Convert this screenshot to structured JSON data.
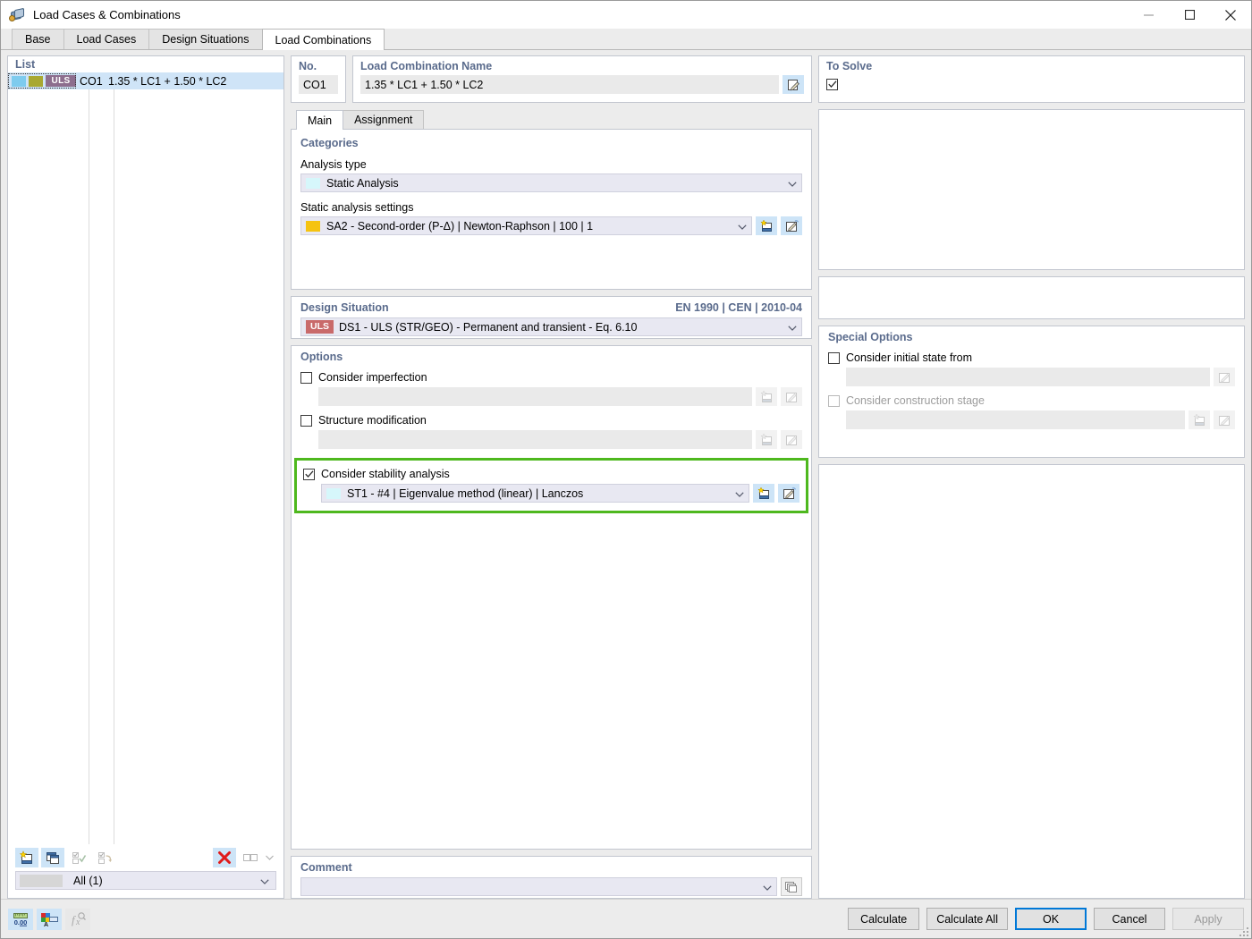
{
  "window": {
    "title": "Load Cases & Combinations",
    "icon": "load-cases-icon",
    "minimize_label": "—",
    "maximize_label": "□",
    "close_label": "✕"
  },
  "tabs": [
    {
      "label": "Base",
      "active": false
    },
    {
      "label": "Load Cases",
      "active": false
    },
    {
      "label": "Design Situations",
      "active": false
    },
    {
      "label": "Load Combinations",
      "active": true
    }
  ],
  "list": {
    "header": "List",
    "rows": [
      {
        "badges": [
          {
            "name": "color-swatch-blue",
            "color": "#7ecbee"
          },
          {
            "name": "color-swatch-olive",
            "color": "#a8a832"
          },
          {
            "name": "uls-badge",
            "color": "#8d6e8e",
            "label": "ULS"
          }
        ],
        "no": "CO1",
        "name": "1.35 * LC1 + 1.50 * LC2"
      }
    ],
    "toolbar": [
      {
        "name": "new-button",
        "icon": "new-icon",
        "state": "enabled"
      },
      {
        "name": "copy-button",
        "icon": "copy-icon",
        "state": "enabled"
      },
      {
        "name": "select-all-button",
        "icon": "check-all-icon",
        "state": "disabled"
      },
      {
        "name": "invert-selection-button",
        "icon": "invert-selection-icon",
        "state": "disabled"
      },
      {
        "name": "delete-button",
        "icon": "delete-x-icon",
        "state": "enabled"
      },
      {
        "name": "view-layout-button",
        "icon": "columns-icon",
        "state": "disabled"
      }
    ],
    "filter": {
      "value": "All (1)",
      "swatch": "#d6d6d6"
    }
  },
  "header": {
    "no_label": "No.",
    "no_value": "CO1",
    "name_label": "Load Combination Name",
    "name_value": "1.35 * LC1 + 1.50 * LC2",
    "name_edit_icon": "edit-pencil-icon",
    "to_solve_label": "To Solve",
    "to_solve_checked": true
  },
  "subtabs": [
    {
      "label": "Main",
      "active": true
    },
    {
      "label": "Assignment",
      "active": false
    }
  ],
  "categories": {
    "group_label": "Categories",
    "analysis_type_label": "Analysis type",
    "analysis_type_value": "Static Analysis",
    "analysis_type_swatch": "#d6f7fb",
    "static_settings_label": "Static analysis settings",
    "static_settings_value": "SA2 - Second-order (P-Δ) | Newton-Raphson | 100 | 1",
    "static_settings_swatch": "#f5c311",
    "new_icon": "new-icon",
    "edit_icon": "edit-icon"
  },
  "design_situation": {
    "group_label": "Design Situation",
    "code": "EN 1990 | CEN | 2010-04",
    "badge": "ULS",
    "badge_color": "#c96a6a",
    "value": "DS1 - ULS (STR/GEO) - Permanent and transient - Eq. 6.10"
  },
  "options": {
    "group_label": "Options",
    "items": [
      {
        "label": "Consider imperfection",
        "checked": false,
        "field_value": "",
        "field_type": "readonly",
        "buttons": [
          {
            "name": "new-imperfection-button",
            "icon": "new-icon",
            "state": "disabled"
          },
          {
            "name": "edit-imperfection-button",
            "icon": "edit-icon",
            "state": "disabled"
          }
        ]
      },
      {
        "label": "Structure modification",
        "checked": false,
        "field_value": "",
        "field_type": "readonly",
        "buttons": [
          {
            "name": "new-structure-modification-button",
            "icon": "new-icon",
            "state": "disabled"
          },
          {
            "name": "edit-structure-modification-button",
            "icon": "edit-icon",
            "state": "disabled"
          }
        ]
      },
      {
        "label": "Consider stability analysis",
        "checked": true,
        "highlighted": true,
        "field_value": "ST1 - #4 | Eigenvalue method (linear) | Lanczos",
        "field_swatch": "#d6f7fb",
        "field_type": "combo",
        "buttons": [
          {
            "name": "new-stability-analysis-button",
            "icon": "new-icon",
            "state": "enabled"
          },
          {
            "name": "edit-stability-analysis-button",
            "icon": "edit-icon",
            "state": "enabled"
          }
        ]
      }
    ],
    "highlight_color": "#4eb81e"
  },
  "special_options": {
    "group_label": "Special Options",
    "items": [
      {
        "label": "Consider initial state from",
        "checked": false,
        "disabled": false,
        "field_value": "",
        "buttons": [
          {
            "name": "edit-initial-state-button",
            "icon": "edit-icon",
            "state": "disabled"
          }
        ]
      },
      {
        "label": "Consider construction stage",
        "checked": false,
        "disabled": true,
        "field_value": "",
        "buttons": [
          {
            "name": "new-construction-stage-button",
            "icon": "new-icon",
            "state": "disabled"
          },
          {
            "name": "edit-construction-stage-button",
            "icon": "edit-icon",
            "state": "disabled"
          }
        ]
      }
    ]
  },
  "comment": {
    "group_label": "Comment",
    "value": "",
    "button": {
      "name": "comment-library-button",
      "icon": "stack-icon",
      "state": "disabled"
    }
  },
  "bottom": {
    "left_icons": [
      {
        "name": "decimal-places-button",
        "icon": "decimal-0-00-icon",
        "state": "enabled"
      },
      {
        "name": "units-and-colors-button",
        "icon": "units-colors-icon",
        "state": "enabled"
      },
      {
        "name": "formula-button",
        "icon": "function-fx-icon",
        "state": "disabled"
      }
    ],
    "buttons": [
      {
        "label": "Calculate",
        "name": "calculate-button",
        "style": "normal"
      },
      {
        "label": "Calculate All",
        "name": "calculate-all-button",
        "style": "normal"
      },
      {
        "label": "OK",
        "name": "ok-button",
        "style": "primary"
      },
      {
        "label": "Cancel",
        "name": "cancel-button",
        "style": "normal"
      },
      {
        "label": "Apply",
        "name": "apply-button",
        "style": "disabled"
      }
    ]
  }
}
